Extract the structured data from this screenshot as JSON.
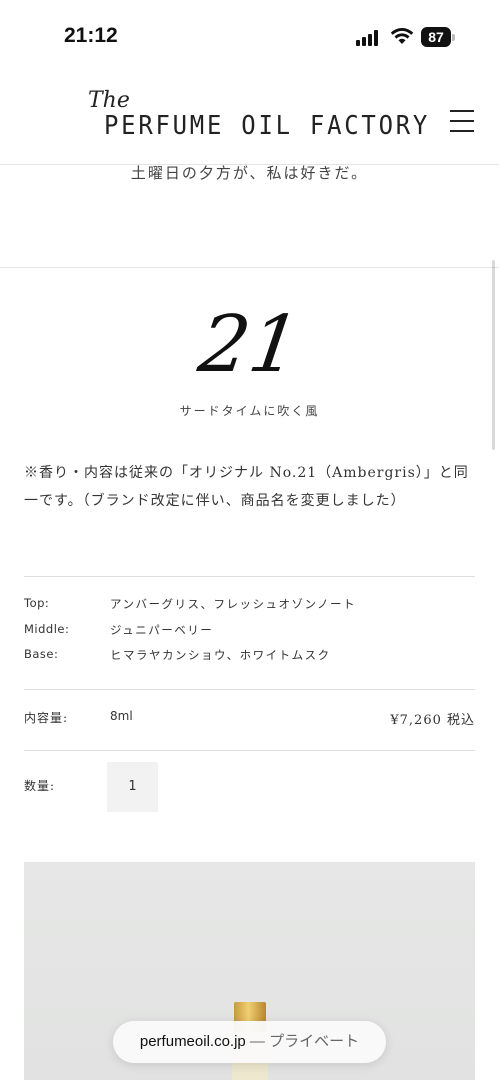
{
  "status_bar": {
    "time": "21:12",
    "battery": "87",
    "icons": [
      "signal-icon",
      "wifi-icon",
      "battery-icon"
    ]
  },
  "header": {
    "logo_the": "The",
    "logo_main": "PERFUME OIL FACTORY",
    "menu_icon": "hamburger-menu-icon"
  },
  "tagline": "土曜日の夕方が、私は好きだ。",
  "product": {
    "number": "21",
    "subtitle": "サードタイムに吹く風",
    "note": "※香り・内容は従来の「オリジナル No.21（Ambergris）」と同一です。（ブランド改定に伴い、商品名を変更しました）",
    "notes": [
      {
        "label": "Top:",
        "value": "アンバーグリス、フレッシュオゾンノート"
      },
      {
        "label": "Middle:",
        "value": "ジュニパーベリー"
      },
      {
        "label": "Base:",
        "value": "ヒマラヤカンショウ、ホワイトムスク"
      }
    ],
    "volume_label": "内容量:",
    "volume_value": "8ml",
    "price": "¥7,260 税込",
    "quantity_label": "数量:",
    "quantity_value": "1"
  },
  "browser": {
    "domain": "perfumeoil.co.jp",
    "separator": " — ",
    "mode": "プライベート"
  },
  "colors": {
    "text": "#333333",
    "divider": "#e3e3e3",
    "qty_bg": "#f2f2f2",
    "image_bg": "#e4e5e4",
    "cap_gold": "#d8ab4c"
  }
}
